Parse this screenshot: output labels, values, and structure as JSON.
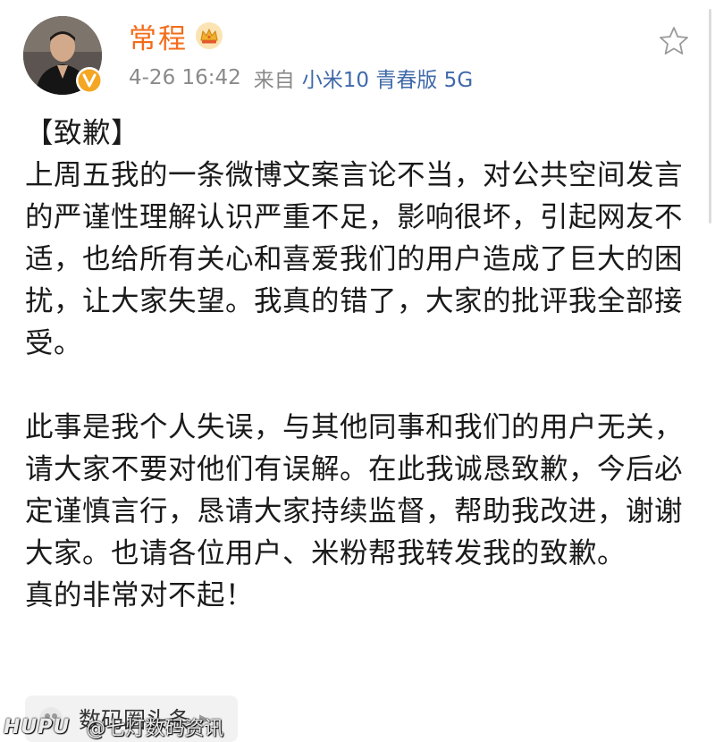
{
  "author": {
    "name": "常程"
  },
  "post_meta": {
    "time": "4-26 16:42",
    "source_prefix": "来自",
    "device": "小米10 青春版 5G"
  },
  "content": {
    "heading": "【致歉】",
    "paragraph_1": "上周五我的一条微博文案言论不当，对公共空间发言的严谨性理解认识严重不足，影响很坏，引起网友不适，也给所有关心和喜爱我们的用户造成了巨大的困扰，让大家失望。我真的错了，大家的批评我全部接受。",
    "paragraph_2": "此事是我个人失误，与其他同事和我们的用户无关，请大家不要对他们有误解。在此我诚恳致歉，今后必定谨慎言行，恳请大家持续监督，帮助我改进，谢谢大家。也请各位用户、米粉帮我转发我的致歉。",
    "closing": "真的非常对不起！"
  },
  "topic": {
    "label": "数码圈头条",
    "chevron": "▶",
    "icon": "topic-icon"
  },
  "watermark": {
    "brand": "HUPU",
    "handle": "@七灯数码资讯"
  },
  "icons": {
    "avatar": "avatar",
    "verified": "verified-badge-icon",
    "vip": "crown-icon",
    "favorite": "star-icon"
  },
  "colors": {
    "author_name": "#f36c1a",
    "device_link": "#3f69a9",
    "meta_text": "#8a8a8a",
    "verified_badge": "#f5a623"
  }
}
